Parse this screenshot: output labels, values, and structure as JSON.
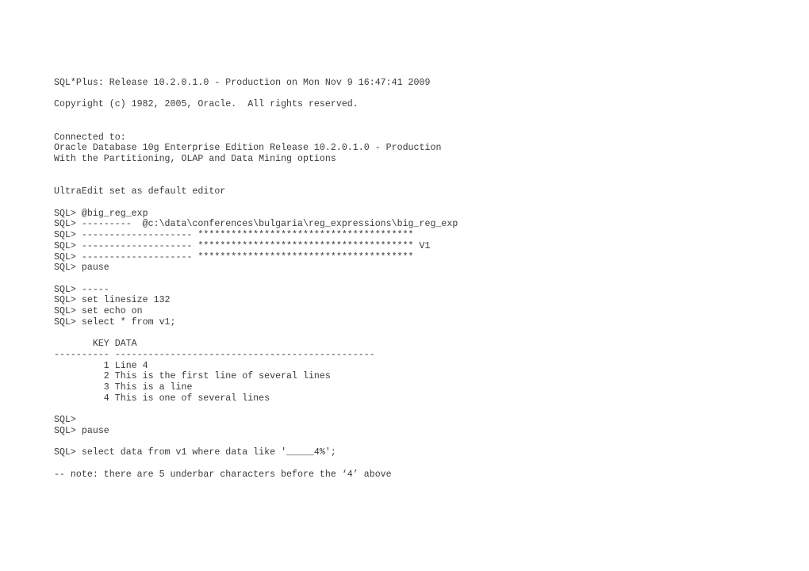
{
  "window": {
    "title": "SQL*Plus Session Transcript",
    "background_color": "#ffffff",
    "text_color": "#3a3a3a"
  },
  "terminal": {
    "prompt": "SQL>",
    "lines": [
      {
        "id": "banner-release",
        "text": "SQL*Plus: Release 10.2.0.1.0 - Production on Mon Nov 9 16:47:41 2009"
      },
      {
        "id": "blank-1",
        "text": ""
      },
      {
        "id": "banner-copyright",
        "text": "Copyright (c) 1982, 2005, Oracle.  All rights reserved."
      },
      {
        "id": "blank-2",
        "text": ""
      },
      {
        "id": "blank-3",
        "text": ""
      },
      {
        "id": "connected-to",
        "text": "Connected to:"
      },
      {
        "id": "db-version",
        "text": "Oracle Database 10g Enterprise Edition Release 10.2.0.1.0 - Production"
      },
      {
        "id": "db-options",
        "text": "With the Partitioning, OLAP and Data Mining options"
      },
      {
        "id": "blank-4",
        "text": ""
      },
      {
        "id": "blank-5",
        "text": ""
      },
      {
        "id": "editor-notice",
        "text": "UltraEdit set as default editor"
      },
      {
        "id": "blank-6",
        "text": ""
      },
      {
        "id": "cmd-run-script",
        "text": "SQL> @big_reg_exp"
      },
      {
        "id": "echo-script-path",
        "text": "SQL> ---------  @c:\\data\\conferences\\bulgaria\\reg_expressions\\big_reg_exp"
      },
      {
        "id": "echo-stars-1",
        "text": "SQL> -------------------- ***************************************"
      },
      {
        "id": "echo-stars-v1",
        "text": "SQL> -------------------- *************************************** V1"
      },
      {
        "id": "echo-stars-2",
        "text": "SQL> -------------------- ***************************************"
      },
      {
        "id": "cmd-pause-1",
        "text": "SQL> pause"
      },
      {
        "id": "blank-7",
        "text": ""
      },
      {
        "id": "echo-dashes-short",
        "text": "SQL> -----"
      },
      {
        "id": "cmd-set-linesize",
        "text": "SQL> set linesize 132"
      },
      {
        "id": "cmd-set-echo",
        "text": "SQL> set echo on"
      },
      {
        "id": "cmd-select-all",
        "text": "SQL> select * from v1;"
      },
      {
        "id": "blank-8",
        "text": ""
      },
      {
        "id": "table-header",
        "text": "       KEY DATA"
      },
      {
        "id": "table-rule",
        "text": "---------- -----------------------------------------------"
      },
      {
        "id": "table-row-1",
        "text": "         1 Line 4"
      },
      {
        "id": "table-row-2",
        "text": "         2 This is the first line of several lines"
      },
      {
        "id": "table-row-3",
        "text": "         3 This is a line"
      },
      {
        "id": "table-row-4",
        "text": "         4 This is one of several lines"
      },
      {
        "id": "blank-9",
        "text": ""
      },
      {
        "id": "prompt-empty",
        "text": "SQL>"
      },
      {
        "id": "cmd-pause-2",
        "text": "SQL> pause"
      },
      {
        "id": "blank-10",
        "text": ""
      },
      {
        "id": "cmd-select-like",
        "text": "SQL> select data from v1 where data like '_____4%';"
      },
      {
        "id": "blank-11",
        "text": ""
      },
      {
        "id": "comment-note",
        "text": "-- note: there are 5 underbar characters before the ‘4’ above"
      }
    ],
    "result_table": {
      "columns": [
        "KEY",
        "DATA"
      ],
      "rows": [
        {
          "KEY": "1",
          "DATA": "Line 4"
        },
        {
          "KEY": "2",
          "DATA": "This is the first line of several lines"
        },
        {
          "KEY": "3",
          "DATA": "This is a line"
        },
        {
          "KEY": "4",
          "DATA": "This is one of several lines"
        }
      ]
    },
    "settings": {
      "linesize": "132",
      "echo": "on",
      "editor": "UltraEdit"
    },
    "script_path": "@c:\\data\\conferences\\bulgaria\\reg_expressions\\big_reg_exp",
    "script_name": "@big_reg_exp",
    "version_marker": "V1",
    "like_pattern": "'_____4%'",
    "underbar_count": "5"
  }
}
